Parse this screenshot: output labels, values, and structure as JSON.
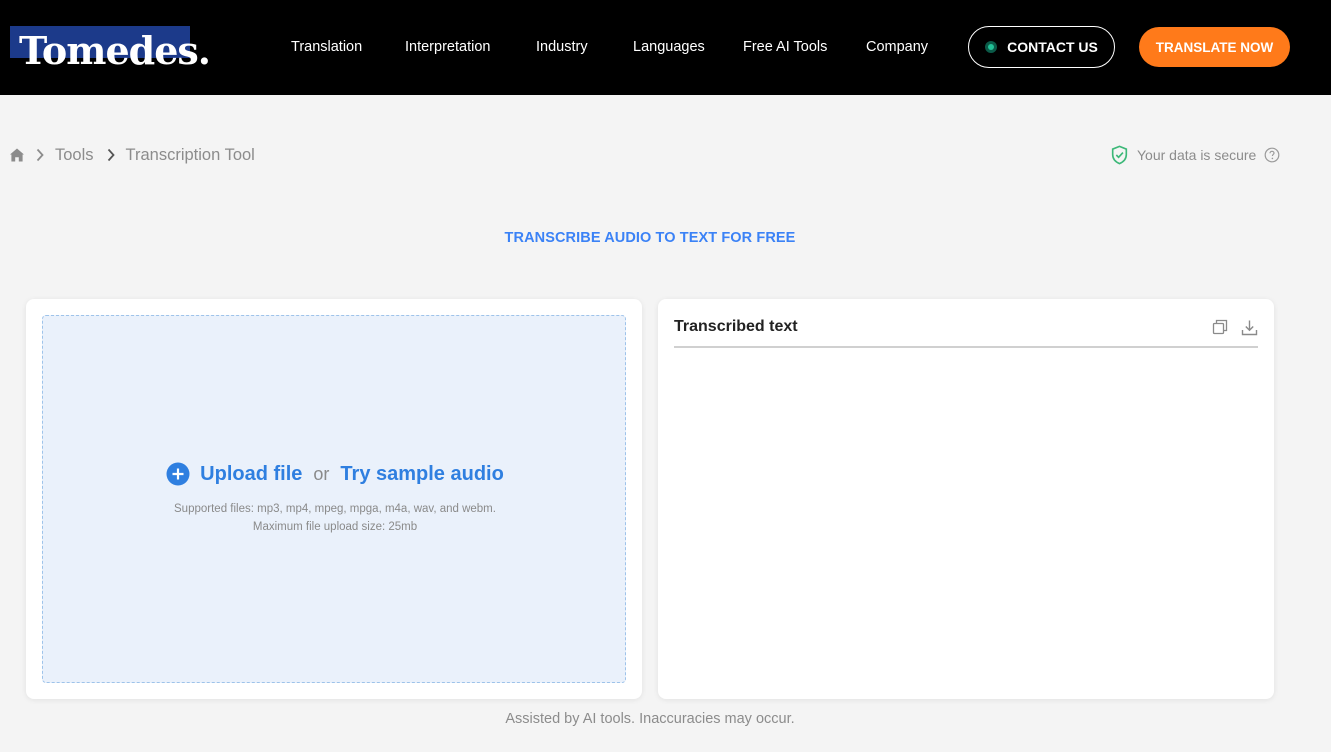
{
  "header": {
    "logo_text": "Tomedes.",
    "nav": [
      "Translation",
      "Interpretation",
      "Industry",
      "Languages",
      "Free AI Tools",
      "Company"
    ],
    "contact_label": "CONTACT US",
    "translate_label": "TRANSLATE NOW",
    "colors": {
      "background": "#000000",
      "cta": "#ff7a1a",
      "logo_block": "#1c3a8a"
    }
  },
  "breadcrumb": {
    "home_icon": "home-icon",
    "items": [
      "Tools",
      "Transcription Tool"
    ]
  },
  "security": {
    "label": "Your data is secure",
    "icon": "shield-check-icon",
    "help_icon": "question-circle-icon"
  },
  "headline": "TRANSCRIBE AUDIO TO TEXT FOR FREE",
  "upload": {
    "upload_label": "Upload file",
    "or_text": "or",
    "sample_label": "Try sample audio",
    "supported": "Supported files: mp3, mp4, mpeg, mpga, m4a, wav, and webm.",
    "max_size": "Maximum file upload size: 25mb",
    "accent": "#2f7fe0"
  },
  "output": {
    "title": "Transcribed text",
    "copy_icon": "copy-icon",
    "download_icon": "download-icon",
    "text": ""
  },
  "footnote": "Assisted by AI tools. Inaccuracies may occur."
}
